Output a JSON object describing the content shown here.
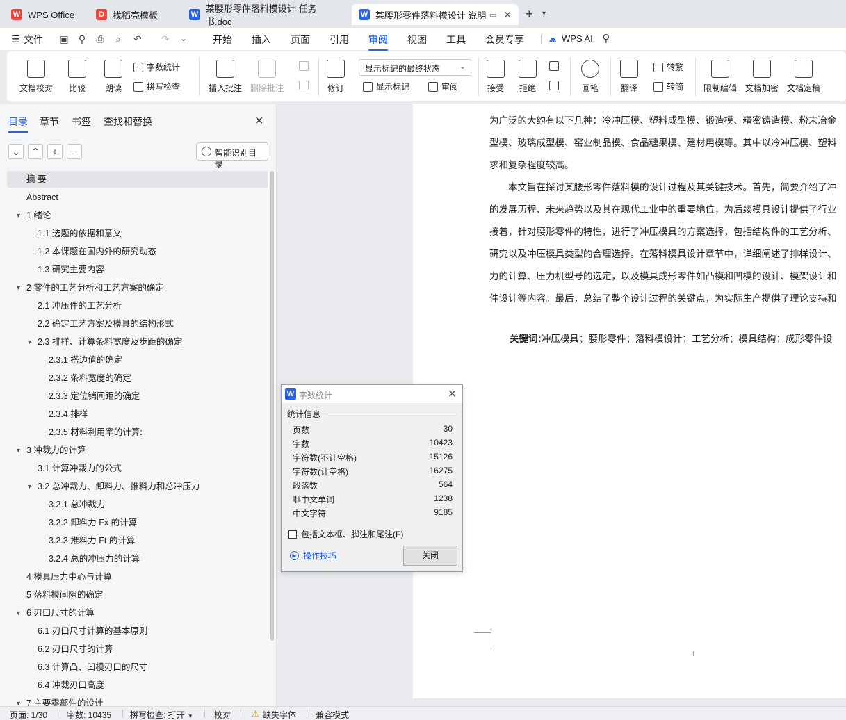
{
  "tabs": [
    {
      "label": "WPS Office",
      "icon": "wps-logo-icon",
      "color": "#e8453c"
    },
    {
      "label": "找稻壳模板",
      "icon": "docer-icon",
      "color": "#e8453c"
    },
    {
      "label": "某腰形零件落料模设计 任务书.doc",
      "icon": "writer-doc-icon",
      "color": "#2a62e0"
    },
    {
      "label": "某腰形零件落料模设计 说明书",
      "icon": "writer-doc-icon",
      "color": "#2a62e0"
    }
  ],
  "menu": {
    "file": "文件",
    "items": [
      "开始",
      "插入",
      "页面",
      "引用",
      "审阅",
      "视图",
      "工具",
      "会员专享"
    ],
    "active": "审阅",
    "ai": "WPS AI"
  },
  "ribbon": {
    "doc_proof": "文档校对",
    "compare": "比较",
    "read_aloud": "朗读",
    "word_count": "字数统计",
    "spell_check": "拼写检查",
    "insert_comment": "插入批注",
    "delete_comment": "删除批注",
    "track_changes": "修订",
    "markup_state": "显示标记的最终状态",
    "show_markup": "显示标记",
    "review_pane": "审阅",
    "accept": "接受",
    "reject": "拒绝",
    "pen": "画笔",
    "translate": "翻译",
    "to_simplified_label": "转繁",
    "to_traditional_label": "转简",
    "restrict_edit": "限制编辑",
    "encrypt": "文档加密",
    "finalize": "文档定稿"
  },
  "nav": {
    "tabs": [
      "目录",
      "章节",
      "书签",
      "查找和替换"
    ],
    "smart_toc": "智能识别目录",
    "toc": [
      {
        "label": "摘 要",
        "level": 1,
        "arrow": false,
        "selected": true
      },
      {
        "label": "Abstract",
        "level": 1,
        "arrow": false
      },
      {
        "label": "1 绪论",
        "level": 1,
        "arrow": true
      },
      {
        "label": "1.1 选题的依据和意义",
        "level": 2,
        "arrow": false
      },
      {
        "label": "1.2 本课题在国内外的研究动态",
        "level": 2,
        "arrow": false
      },
      {
        "label": "1.3 研究主要内容",
        "level": 2,
        "arrow": false
      },
      {
        "label": "2 零件的工艺分析和工艺方案的确定",
        "level": 1,
        "arrow": true
      },
      {
        "label": "2.1 冲压件的工艺分析",
        "level": 2,
        "arrow": false
      },
      {
        "label": "2.2 确定工艺方案及模具的结构形式",
        "level": 2,
        "arrow": false
      },
      {
        "label": "2.3 排样、计算条料宽度及步距的确定",
        "level": 2,
        "arrow": true
      },
      {
        "label": "2.3.1 搭边值的确定",
        "level": 3,
        "arrow": false
      },
      {
        "label": "2.3.2 条料宽度的确定",
        "level": 3,
        "arrow": false
      },
      {
        "label": "2.3.3 定位销间距的确定",
        "level": 3,
        "arrow": false
      },
      {
        "label": "2.3.4 排样",
        "level": 3,
        "arrow": false
      },
      {
        "label": "2.3.5 材料利用率的计算:",
        "level": 3,
        "arrow": false
      },
      {
        "label": "3 冲裁力的计算",
        "level": 1,
        "arrow": true
      },
      {
        "label": "3.1 计算冲裁力的公式",
        "level": 2,
        "arrow": false
      },
      {
        "label": "3.2 总冲裁力、卸料力、推料力和总冲压力",
        "level": 2,
        "arrow": true
      },
      {
        "label": "3.2.1 总冲裁力",
        "level": 3,
        "arrow": false
      },
      {
        "label": "3.2.2 卸料力 Fx 的计算",
        "level": 3,
        "arrow": false
      },
      {
        "label": "3.2.3 推料力 Ft 的计算",
        "level": 3,
        "arrow": false
      },
      {
        "label": "3.2.4 总的冲压力的计算",
        "level": 3,
        "arrow": false
      },
      {
        "label": "4 模具压力中心与计算",
        "level": 1,
        "arrow": false
      },
      {
        "label": "5 落料模间隙的确定",
        "level": 1,
        "arrow": false
      },
      {
        "label": "6 刃口尺寸的计算",
        "level": 1,
        "arrow": true
      },
      {
        "label": "6.1 刃口尺寸计算的基本原则",
        "level": 2,
        "arrow": false
      },
      {
        "label": "6.2 刃口尺寸的计算",
        "level": 2,
        "arrow": false
      },
      {
        "label": "6.3 计算凸、凹模刃口的尺寸",
        "level": 2,
        "arrow": false
      },
      {
        "label": "6.4 冲裁刃口高度",
        "level": 2,
        "arrow": false
      },
      {
        "label": "7 主要零部件的设计",
        "level": 1,
        "arrow": true
      }
    ]
  },
  "document": {
    "lines": [
      "为广泛的大约有以下几种：冷冲压模、塑料成型模、锻造模、精密铸造模、粉末冶金",
      "型模、玻璃成型模、窑业制品模、食品糖果模、建材用模等。其中以冷冲压模、塑料",
      "求和复杂程度较高。",
      "　　本文旨在探讨某腰形零件落料模的设计过程及其关键技术。首先，简要介绍了冲",
      "的发展历程、未来趋势以及其在现代工业中的重要地位，为后续模具设计提供了行业",
      "接着，针对腰形零件的特性，进行了冲压模具的方案选择，包括结构件的工艺分析、",
      "研究以及冲压模具类型的合理选择。在落料模具设计章节中，详细阐述了排样设计、",
      "力的计算、压力机型号的选定，以及模具成形零件如凸模和凹模的设计、模架设计和",
      "件设计等内容。最后，总结了整个设计过程的关键点，为实际生产提供了理论支持和"
    ],
    "keywords_label": "关键词:",
    "keywords": "冲压模具；腰形零件；落料模设计；工艺分析；模具结构；成形零件设"
  },
  "dialog": {
    "title": "字数统计",
    "section": "统计信息",
    "stats": [
      {
        "label": "页数",
        "value": "30"
      },
      {
        "label": "字数",
        "value": "10423"
      },
      {
        "label": "字符数(不计空格)",
        "value": "15126"
      },
      {
        "label": "字符数(计空格)",
        "value": "16275"
      },
      {
        "label": "段落数",
        "value": "564"
      },
      {
        "label": "非中文单词",
        "value": "1238"
      },
      {
        "label": "中文字符",
        "value": "9185"
      }
    ],
    "include_checkbox": "包括文本框、脚注和尾注(F)",
    "tips": "操作技巧",
    "close_button": "关闭"
  },
  "status": {
    "page": "页面: 1/30",
    "words": "字数: 10435",
    "spell": "拼写检查: 打开",
    "proof": "校对",
    "missing_font": "缺失字体",
    "compat": "兼容模式"
  },
  "colors": {
    "accent": "#2a62e0",
    "wps_red": "#e8453c"
  }
}
